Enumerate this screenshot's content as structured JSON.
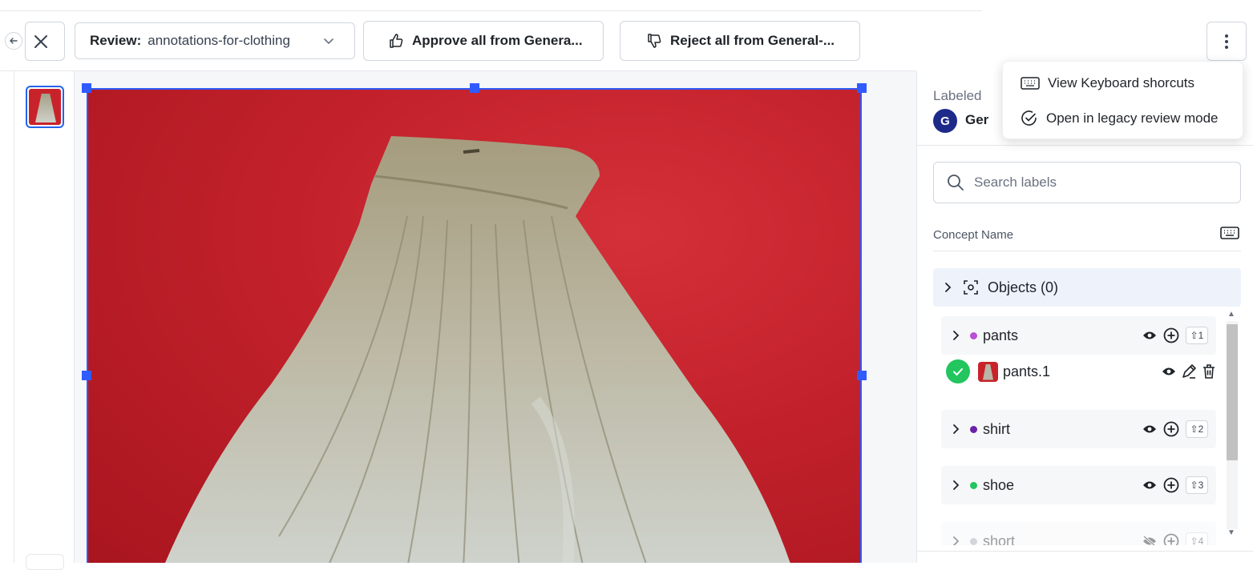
{
  "toolbar": {
    "review_label": "Review:",
    "review_value": "annotations-for-clothing",
    "approve_label": "Approve all from Genera...",
    "reject_label": "Reject all from General-..."
  },
  "menu": {
    "items": [
      {
        "label": "View Keyboard shorcuts",
        "icon": "keyboard-icon"
      },
      {
        "label": "Open in legacy review mode",
        "icon": "check-circle-icon"
      }
    ]
  },
  "panel": {
    "labeled_by": "Labeled",
    "avatar_letter": "G",
    "labeler_name": "Ger",
    "search_placeholder": "Search labels",
    "concept_header": "Concept Name",
    "objects_label": "Objects (0)",
    "concepts": [
      {
        "name": "pants",
        "color": "#b84fd6",
        "hotkey": "⇧1"
      },
      {
        "name": "shirt",
        "color": "#6b21a8",
        "hotkey": "⇧2"
      },
      {
        "name": "shoe",
        "color": "#22c55e",
        "hotkey": "⇧3"
      },
      {
        "name": "short",
        "color": "#9ca3af",
        "hotkey": "⇧4"
      }
    ],
    "annotation": {
      "name": "pants.1"
    }
  },
  "colors": {
    "accent": "#2f5bff",
    "approve_check": "#22c55e",
    "avatar": "#1e2a8a",
    "photo_background": "#c4222c"
  }
}
